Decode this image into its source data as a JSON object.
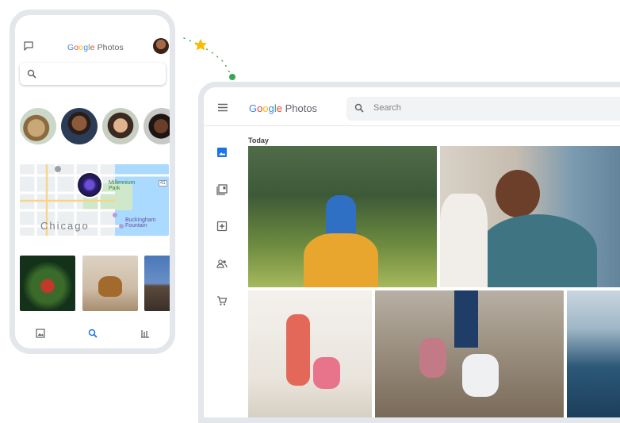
{
  "brand": {
    "google": [
      "G",
      "o",
      "o",
      "g",
      "l",
      "e"
    ],
    "google_colors": [
      "#4285F4",
      "#EA4335",
      "#FBBC05",
      "#4285F4",
      "#34A853",
      "#EA4335"
    ],
    "product": "Photos"
  },
  "mobile": {
    "map_label": "Chicago",
    "map_poi_1": "Millennium Park",
    "map_poi_1_line1": "Millennium",
    "map_poi_1_line2": "Park",
    "map_poi_2_line1": "Buckingham",
    "map_poi_2_line2": "Fountain",
    "map_badge": "41",
    "nav": [
      "photos-icon",
      "search-icon",
      "library-icon"
    ],
    "active_nav": "search-icon"
  },
  "desktop": {
    "search_placeholder": "Search",
    "section_label": "Today",
    "side_nav": [
      "photos-icon",
      "albums-icon",
      "assistant-icon",
      "sharing-icon",
      "print-store-icon"
    ],
    "active_side_nav": "photos-icon"
  },
  "colors": {
    "accent": "#1a73e8",
    "frame": "#e3e6ea",
    "icon_grey": "#5f6368"
  }
}
